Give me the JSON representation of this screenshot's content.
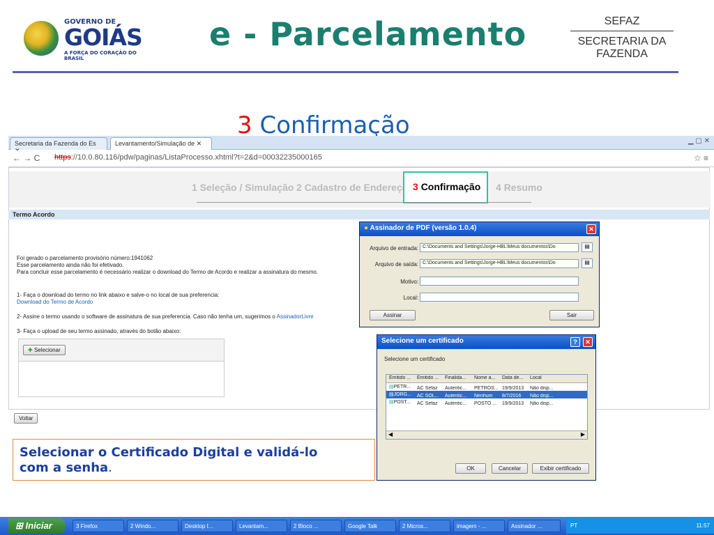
{
  "slide": {
    "logo": {
      "governo": "GOVERNO DE",
      "goias": "GOIÁS",
      "tagline": "A FORÇA DO CORAÇÃO DO BRASIL"
    },
    "title": "e - Parcelamento",
    "sefaz": {
      "top": "SEFAZ",
      "bottom": "SECRETARIA DA FAZENDA"
    },
    "step_number": "3",
    "step_label": "Confirmação",
    "callout": {
      "line1": "Selecionar o Certificado Digital e validá-lo",
      "line2": "com a senha",
      "end": "."
    }
  },
  "browser": {
    "tabs": [
      "Secretaria da Fazenda do Es",
      "Levantamento/Simulação de"
    ],
    "url_scheme": "https",
    "url_rest": "://10.0.80.116/pdw/paginas/ListaProcesso.xhtml?t=2&d=00032235000165",
    "steps": [
      {
        "num": "1",
        "label": "Seleção / Simulação"
      },
      {
        "num": "2",
        "label": "Cadastro de Endereço"
      },
      {
        "num": "3",
        "label": "Confirmação"
      },
      {
        "num": "4",
        "label": "Resumo"
      }
    ],
    "section_title": "Termo Acordo",
    "para1": "Foi gerado o parcelamento provisório número:1941062",
    "para2": "Esse parcelamento ainda não foi efetivado.",
    "para3": "Para concluir esse parcelamento é necessário realizar o download do Termo de Acordo e realizar a assinatura do mesmo.",
    "item1": "1- Faça o download do termo no link abaixo e salve-o no local de sua preferencia:",
    "item1_link": "Download do Termo de Acordo",
    "item2": "2- Assine o termo usando o software de assinatura de sua preferencia. Caso não tenha um, sugerimos o",
    "item2_link": "AssinadorLivre",
    "item3": "3- Faça o upload de seu termo assinado, através do botão abaixo:",
    "select_button": "Selecionar",
    "back_button": "Voltar"
  },
  "signer": {
    "title": "Assinador de PDF (versão 1.0.4)",
    "input_label": "Arquivo de entrada:",
    "input_value": "C:\\Documents and Settings\\Jorge-HBL\\Meus documentos\\Do",
    "output_label": "Arquivo de saída:",
    "output_value": "C:\\Documents and Settings\\Jorge-HBL\\Meus documentos\\Do",
    "motivo_label": "Motivo:",
    "local_label": "Local:",
    "sign_button": "Assinar",
    "exit_button": "Sair"
  },
  "cert": {
    "title": "Selecione um certificado",
    "prompt": "Selecione um certificado",
    "headers": [
      "Emitido ...",
      "Emitido ...",
      "Finalida...",
      "Nome a...",
      "Data de...",
      "Local"
    ],
    "rows": [
      [
        "PETR...",
        "AC Sefaz",
        "Autentic...",
        "PETROS...",
        "19/9/2013",
        "Não disp..."
      ],
      [
        "JORG...",
        "AC SOL...",
        "Autentic...",
        "Nenhum",
        "8/7/2016",
        "Não disp..."
      ],
      [
        "POST...",
        "AC Sefaz",
        "Autentic...",
        "POSTO ...",
        "19/9/2013",
        "Não disp..."
      ]
    ],
    "ok": "OK",
    "cancel": "Cancelar",
    "show": "Exibir certificado"
  },
  "taskbar": {
    "start": "Iniciar",
    "tasks": [
      "3 Firefox",
      "2 Windo...",
      "Desktop I...",
      "Levantam...",
      "2 Bloco ...",
      "Google Talk",
      "2 Micros...",
      "imagem - ...",
      "Assinador ..."
    ],
    "lang": "PT",
    "clock": "11:57"
  }
}
